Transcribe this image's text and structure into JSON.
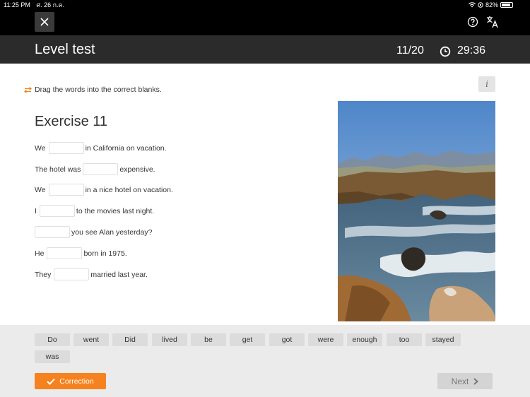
{
  "status": {
    "time": "11:25 PM",
    "date": "ศ. 26 ก.ค.",
    "battery": "82%"
  },
  "header": {
    "title": "Level test",
    "progress": "11/20",
    "timer": "29:36"
  },
  "instruction": "Drag the words into the correct blanks.",
  "info_label": "i",
  "exercise": {
    "title": "Exercise 11",
    "sentences": [
      {
        "before": "We",
        "after": "in California on vacation."
      },
      {
        "before": "The hotel was",
        "after": "expensive."
      },
      {
        "before": "We",
        "after": "in a nice hotel on vacation."
      },
      {
        "before": "I",
        "after": "to the movies last night."
      },
      {
        "before": "",
        "after": "you see Alan yesterday?"
      },
      {
        "before": "He",
        "after": "born in 1975."
      },
      {
        "before": "They",
        "after": "married last year."
      }
    ]
  },
  "word_bank": [
    "Do",
    "went",
    "Did",
    "lived",
    "be",
    "get",
    "got",
    "were",
    "enough",
    "too",
    "stayed",
    "was"
  ],
  "buttons": {
    "correction": "Correction",
    "next": "Next"
  }
}
